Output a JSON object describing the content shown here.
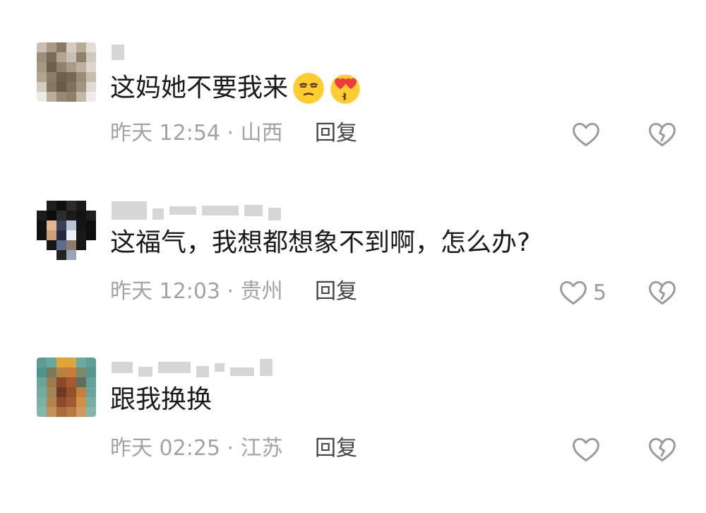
{
  "comments": [
    {
      "text": "这妈她不要我来",
      "emojis": [
        "smirk-face-emoji",
        "heart-eyes-kiss-emoji"
      ],
      "meta": "昨天 12:54 · 山西",
      "reply_label": "回复",
      "like_count": "",
      "avatar_colors": [
        "#c9bfb2",
        "#a99a86",
        "#8a7b68",
        "#d5cdc4",
        "#b7aa98",
        "#e2ddd6",
        "#9d8f7c",
        "#7a6a56",
        "#b3a48f",
        "#c9c0b3",
        "#8f806b",
        "#d0c8bd",
        "#a69782",
        "#6e5f4c",
        "#907f6a",
        "#a89a87",
        "#bcb0a0",
        "#ddd6cd",
        "#b1a391",
        "#8b7c68",
        "#6f604e",
        "#766654",
        "#9a8b77",
        "#c6bcae",
        "#d4ccc1",
        "#857663",
        "#6a5b49",
        "#7f705d",
        "#a39481",
        "#e0dad2",
        "#eeeae4",
        "#b9ad9d",
        "#978873",
        "#8d7e69",
        "#c2b7a8",
        "#f0ece7"
      ]
    },
    {
      "text": "这福气，我想都想象不到啊，怎么办?",
      "emojis": [],
      "meta": "昨天 12:03 · 贵州",
      "reply_label": "回复",
      "like_count": "5",
      "avatar_colors": [
        "#ffffff",
        "#1d1d1d",
        "#0f0f0f",
        "#2b2b2b",
        "#1a1a1a",
        "#ffffff",
        "#1c1c1c",
        "#0d0d0d",
        "#2c2c2c",
        "#1b1b1b",
        "#121212",
        "#1e1e1e",
        "#101010",
        "#e6b48a",
        "#3a3f58",
        "#b9c2d6",
        "#141414",
        "#0e0e0e",
        "#111111",
        "#caa07c",
        "#262a3f",
        "#eef1f7",
        "#181818",
        "#0c0c0c",
        "#ffffff",
        "#171717",
        "#5c6c8a",
        "#8f7a6b",
        "#151515",
        "#ffffff",
        "#ffffff",
        "#ffffff",
        "#222",
        "#9aa3b5",
        "#ffffff",
        "#ffffff"
      ]
    },
    {
      "text": "跟我换换",
      "emojis": [],
      "meta": "昨天 02:25 · 江苏",
      "reply_label": "回复",
      "like_count": "",
      "avatar_colors": [
        "#5a9c94",
        "#68a89f",
        "#e2a33a",
        "#dca43c",
        "#6aa9a0",
        "#5e9f97",
        "#4f938b",
        "#7a7a5c",
        "#b58240",
        "#c47d3a",
        "#7b8a6a",
        "#52968e",
        "#6aa59d",
        "#9c7b4e",
        "#8a4a2a",
        "#a8592f",
        "#5d6f5a",
        "#63a199",
        "#70ac9f",
        "#a08758",
        "#6e3a22",
        "#94502c",
        "#c4813e",
        "#6aa59d",
        "#7bb1a5",
        "#b28450",
        "#8d4b2b",
        "#9f5a33",
        "#d0904a",
        "#77ae9f",
        "#86b6a9",
        "#c0915c",
        "#a96c3e",
        "#b87a45",
        "#cb9a5e",
        "#86b6a9"
      ]
    }
  ]
}
